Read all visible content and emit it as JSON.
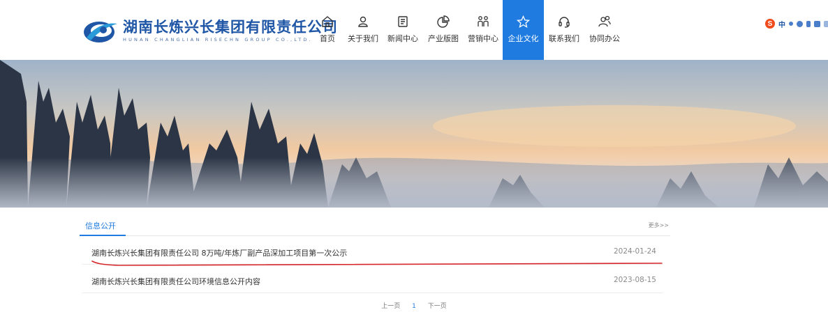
{
  "header": {
    "company_cn": "湖南长炼兴长集团有限责任公司",
    "company_en": "HUNAN CHANGLIAN RISECHN GROUP CO.,LTD.",
    "nav": [
      {
        "label": "首页",
        "icon": "home-icon"
      },
      {
        "label": "关于我们",
        "icon": "person-icon"
      },
      {
        "label": "新闻中心",
        "icon": "news-icon"
      },
      {
        "label": "产业版图",
        "icon": "pie-chart-icon"
      },
      {
        "label": "营销中心",
        "icon": "team-icon"
      },
      {
        "label": "企业文化",
        "icon": "star-icon",
        "active": true
      },
      {
        "label": "联系我们",
        "icon": "headset-icon"
      },
      {
        "label": "协同办公",
        "icon": "users-icon"
      }
    ],
    "active_color": "#1f7be0"
  },
  "ime_toolbar": {
    "s_logo": "S",
    "mode": "中"
  },
  "info": {
    "tab_label": "信息公开",
    "more_label": "更多>>",
    "items": [
      {
        "title": "湖南长炼兴长集团有限责任公司 8万吨/年炼厂副产品深加工项目第一次公示",
        "date": "2024-01-24"
      },
      {
        "title": "湖南长炼兴长集团有限责任公司环境信息公开内容",
        "date": "2023-08-15"
      }
    ]
  },
  "pager": {
    "prev": "上一页",
    "current": "1",
    "next": "下一页"
  }
}
